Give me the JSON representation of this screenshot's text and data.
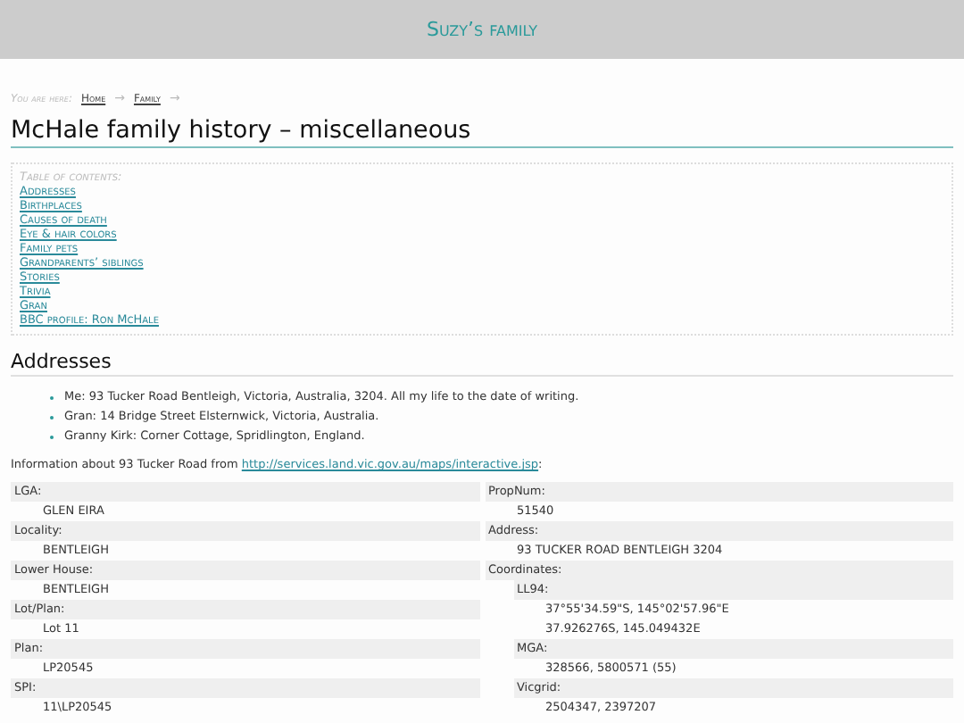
{
  "site_title": "Suzy’s family",
  "breadcrumb": {
    "label": "You are here:",
    "links": [
      "Home",
      "Family"
    ],
    "separator": "→"
  },
  "page_title": "McHale family history – miscellaneous",
  "toc": {
    "title": "Table of contents:",
    "items": [
      "Addresses",
      "Birthplaces",
      "Causes of death",
      "Eye & hair colors",
      "Family pets",
      "Grandparents’ siblings",
      "Stories",
      "Trivia",
      "Gran",
      "BBC profile: Ron McHale"
    ]
  },
  "section_title": "Addresses",
  "addresses": [
    "Me: 93 Tucker Road Bentleigh, Victoria, Australia, 3204. All my life to the date of writing.",
    "Gran: 14 Bridge Street Elsternwick, Victoria, Australia.",
    "Granny Kirk: Corner Cottage, Spridlington, England."
  ],
  "info": {
    "text": "Information about 93 Tucker Road from",
    "link": "http://services.land.vic.gov.au/maps/interactive.jsp",
    "suffix": ":"
  },
  "property_columns": [
    [
      {
        "label": "LGA:",
        "values": [
          "GLEN EIRA"
        ]
      },
      {
        "label": "Locality:",
        "values": [
          "BENTLEIGH"
        ]
      },
      {
        "label": "Lower House:",
        "values": [
          "BENTLEIGH"
        ]
      },
      {
        "label": "Lot/Plan:",
        "values": [
          "Lot 11"
        ]
      },
      {
        "label": "Plan:",
        "values": [
          "LP20545"
        ]
      },
      {
        "label": "SPI:",
        "values": [
          "11\\LP20545"
        ]
      }
    ],
    [
      {
        "label": "PropNum:",
        "values": [
          "51540"
        ]
      },
      {
        "label": "Address:",
        "values": [
          "93 TUCKER ROAD BENTLEIGH 3204"
        ]
      },
      {
        "label": "Coordinates:",
        "children": [
          {
            "label": "LL94:",
            "values": [
              "37°55'34.59\"S, 145°02'57.96\"E",
              "37.926276S, 145.049432E"
            ]
          },
          {
            "label": "MGA:",
            "values": [
              "328566, 5800571 (55)"
            ]
          },
          {
            "label": "Vicgrid:",
            "values": [
              "2504347, 2397207"
            ]
          }
        ]
      }
    ]
  ]
}
